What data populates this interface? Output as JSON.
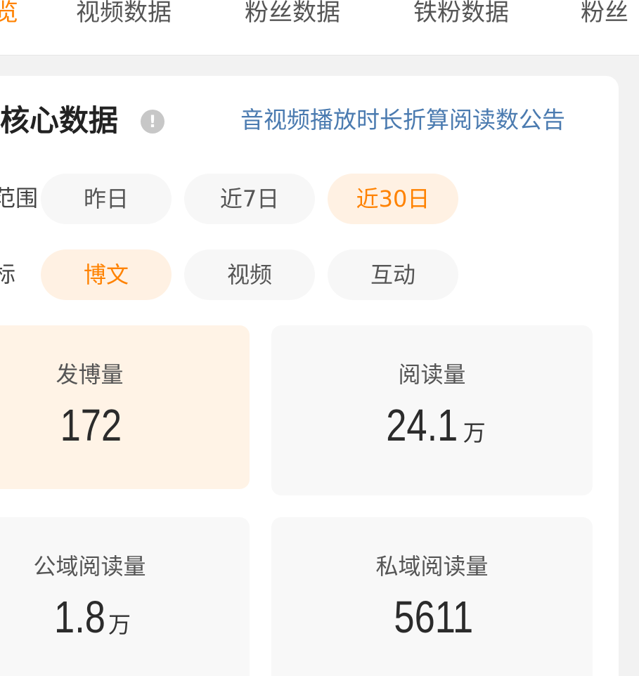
{
  "tabs": [
    "览",
    "视频数据",
    "粉丝数据",
    "铁粉数据",
    "粉丝"
  ],
  "core": {
    "title": "核心数据",
    "info_icon": "!",
    "notice": "音视频播放时长折算阅读数公告"
  },
  "range": {
    "label": "范围",
    "options": [
      "昨日",
      "近7日",
      "近30日"
    ],
    "selected": "近30日"
  },
  "metric_type": {
    "label": "标",
    "options": [
      "博文",
      "视频",
      "互动"
    ],
    "selected": "博文"
  },
  "metrics": [
    {
      "label": "发博量",
      "value": "172",
      "unit": ""
    },
    {
      "label": "阅读量",
      "value": "24.1",
      "unit": "万"
    },
    {
      "label": "公域阅读量",
      "value": "1.8",
      "unit": "万"
    },
    {
      "label": "私域阅读量",
      "value": "5611",
      "unit": ""
    }
  ],
  "colors": {
    "accent": "#ff8200",
    "link": "#4b7bb0",
    "active_bg": "#fff1e3"
  }
}
